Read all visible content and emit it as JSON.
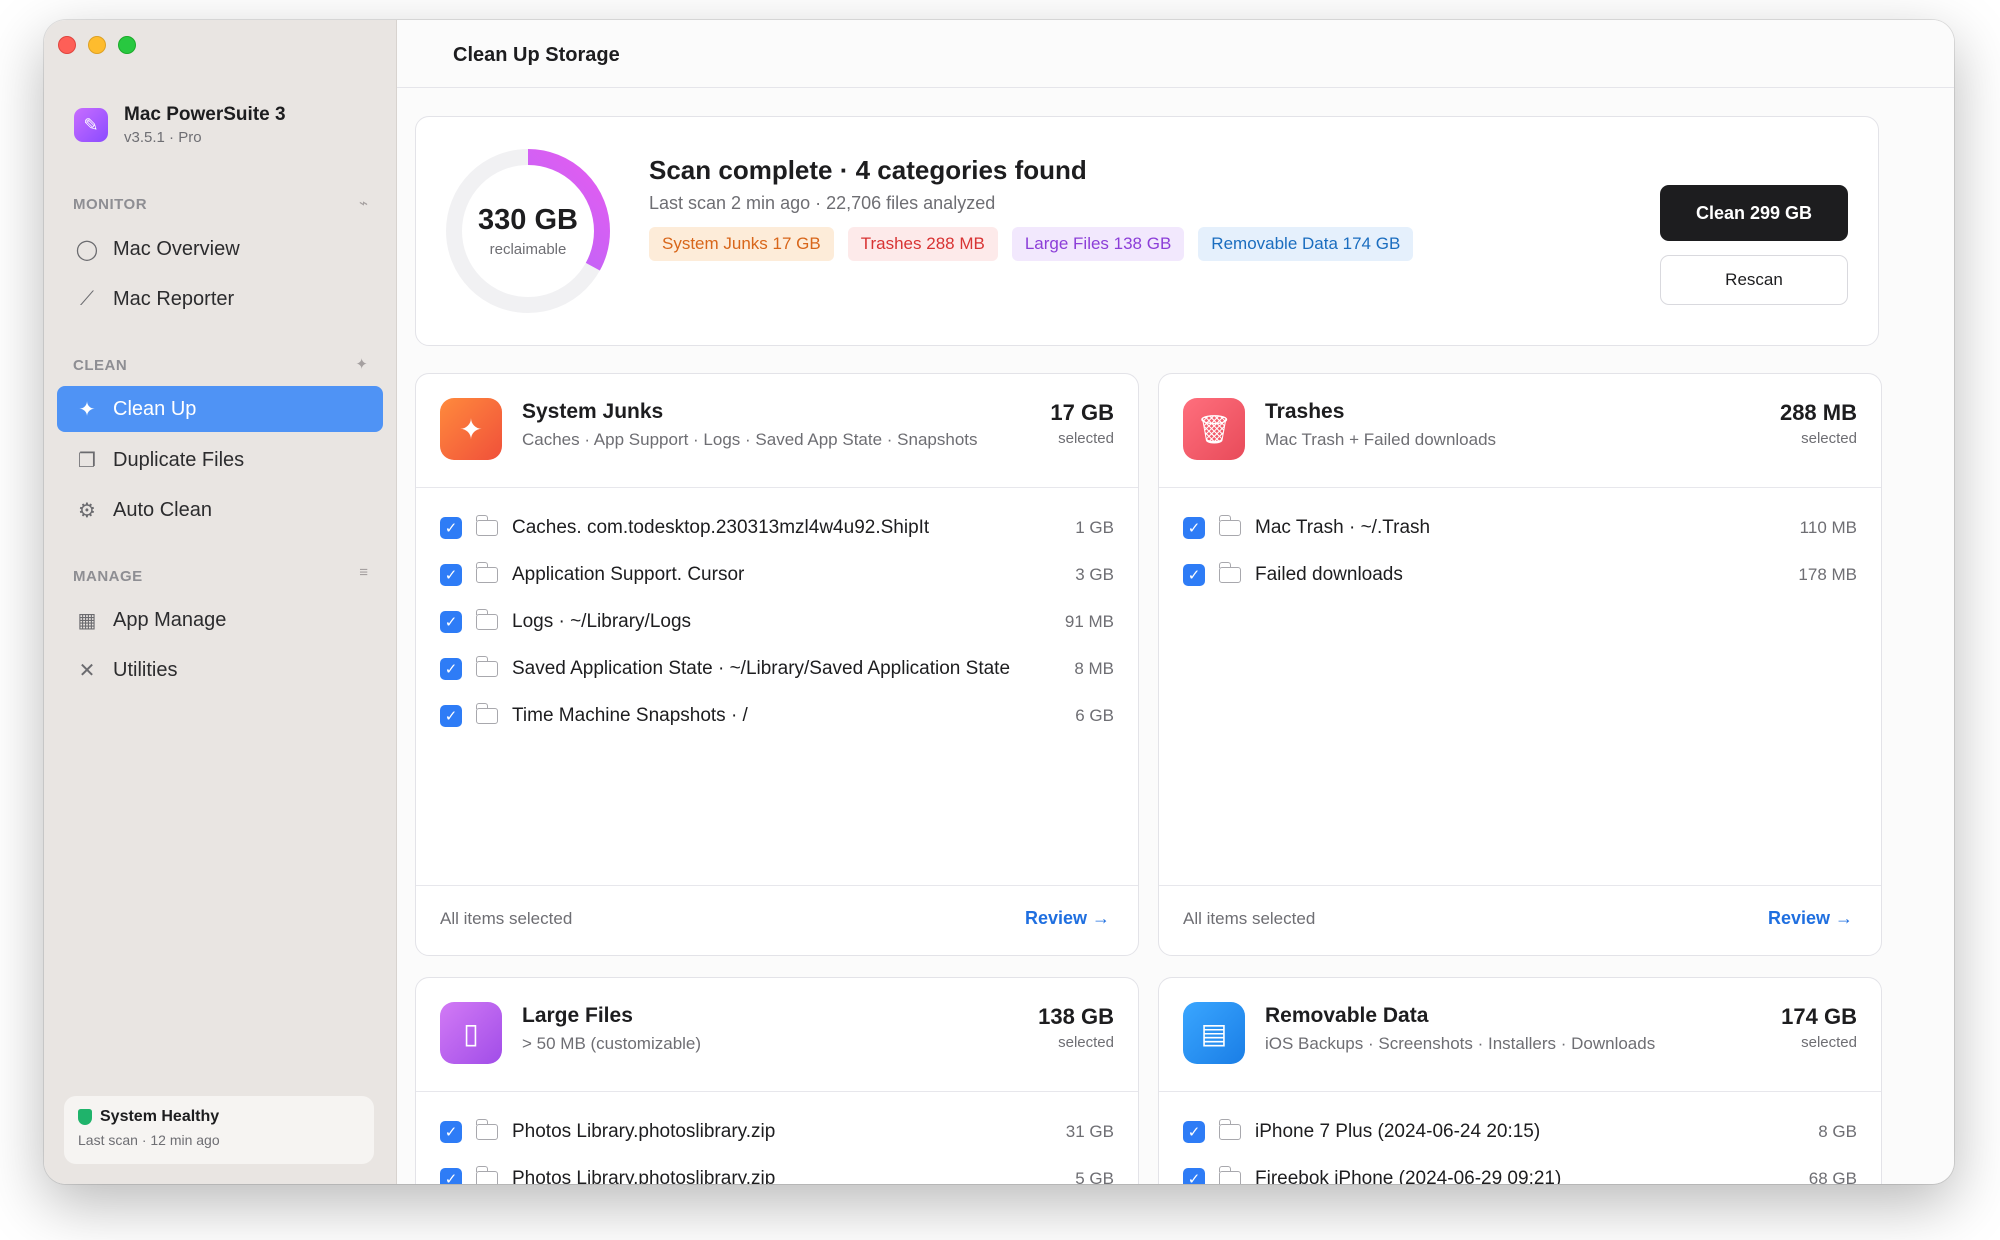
{
  "app": {
    "name": "Mac PowerSuite 3",
    "version": "v3.5.1 · Pro"
  },
  "sidebar": {
    "sections": [
      {
        "label": "MONITOR",
        "items": [
          {
            "label": "Mac Overview",
            "icon": "circle-icon"
          },
          {
            "label": "Mac Reporter",
            "icon": "chart-icon"
          }
        ]
      },
      {
        "label": "CLEAN",
        "items": [
          {
            "label": "Clean Up",
            "icon": "sparkle-icon",
            "active": true
          },
          {
            "label": "Duplicate Files",
            "icon": "documents-icon"
          },
          {
            "label": "Auto Clean",
            "icon": "gears-icon"
          }
        ]
      },
      {
        "label": "MANAGE",
        "items": [
          {
            "label": "App Manage",
            "icon": "grid-icon"
          },
          {
            "label": "Utilities",
            "icon": "tools-icon"
          }
        ]
      }
    ],
    "health": {
      "title": "System Healthy",
      "subtitle": "Last scan · 12 min ago"
    }
  },
  "header": {
    "title": "Clean Up Storage"
  },
  "summary": {
    "reclaimable_value": "330 GB",
    "reclaimable_label": "reclaimable",
    "title": "Scan complete · 4 categories found",
    "subtitle": "Last scan 2 min ago · 22,706 files analyzed",
    "chips": [
      {
        "label": "System Junks 17 GB",
        "color": "#d8661a"
      },
      {
        "label": "Trashes 288 MB",
        "color": "#d83333"
      },
      {
        "label": "Large Files 138 GB",
        "color": "#8c3ed8"
      },
      {
        "label": "Removable Data 174 GB",
        "color": "#1a6dbf"
      }
    ],
    "clean_button": "Clean 299 GB",
    "rescan_button": "Rescan",
    "ring_progress": 0.33
  },
  "categories": [
    {
      "title": "System Junks",
      "subtitle": "Caches · App Support · Logs · Saved App State · Snapshots",
      "size": "17 GB",
      "selected_label": "selected",
      "icon": "sparkle-icon",
      "icon_color": "#f5703a",
      "rows": [
        {
          "name": "Caches. com.todesktop.230313mzl4w4u92.ShipIt",
          "size": "1 GB"
        },
        {
          "name": "Application Support. Cursor",
          "size": "3 GB"
        },
        {
          "name": "Logs · ~/Library/Logs",
          "size": "91 MB"
        },
        {
          "name": "Saved Application State · ~/Library/Saved Application State",
          "size": "8 MB"
        },
        {
          "name": "Time Machine Snapshots · /",
          "size": "6 GB"
        }
      ],
      "footer_left": "All items selected",
      "footer_right": "Review →"
    },
    {
      "title": "Trashes",
      "subtitle": "Mac Trash + Failed downloads",
      "size": "288 MB",
      "selected_label": "selected",
      "icon": "trash-icon",
      "icon_color": "#f05a67",
      "rows": [
        {
          "name": "Mac Trash · ~/.Trash",
          "size": "110 MB"
        },
        {
          "name": "Failed downloads",
          "size": "178 MB"
        }
      ],
      "footer_left": "All items selected",
      "footer_right": "Review →"
    },
    {
      "title": "Large Files",
      "subtitle": "> 50 MB (customizable)",
      "size": "138 GB",
      "selected_label": "selected",
      "icon": "zip-icon",
      "icon_color": "#b45cf0",
      "rows": [
        {
          "name": "Photos Library.photoslibrary.zip",
          "size": "31 GB"
        },
        {
          "name": "Photos Library.photoslibrary.zip",
          "size": "5 GB"
        }
      ]
    },
    {
      "title": "Removable Data",
      "subtitle": "iOS Backups · Screenshots · Installers · Downloads",
      "size": "174 GB",
      "selected_label": "selected",
      "icon": "archive-icon",
      "icon_color": "#1e8ff0",
      "rows": [
        {
          "name": "iPhone 7 Plus (2024-06-24 20:15)",
          "size": "8 GB"
        },
        {
          "name": "Fireebok iPhone (2024-06-29 09:21)",
          "size": "68 GB"
        }
      ]
    }
  ]
}
